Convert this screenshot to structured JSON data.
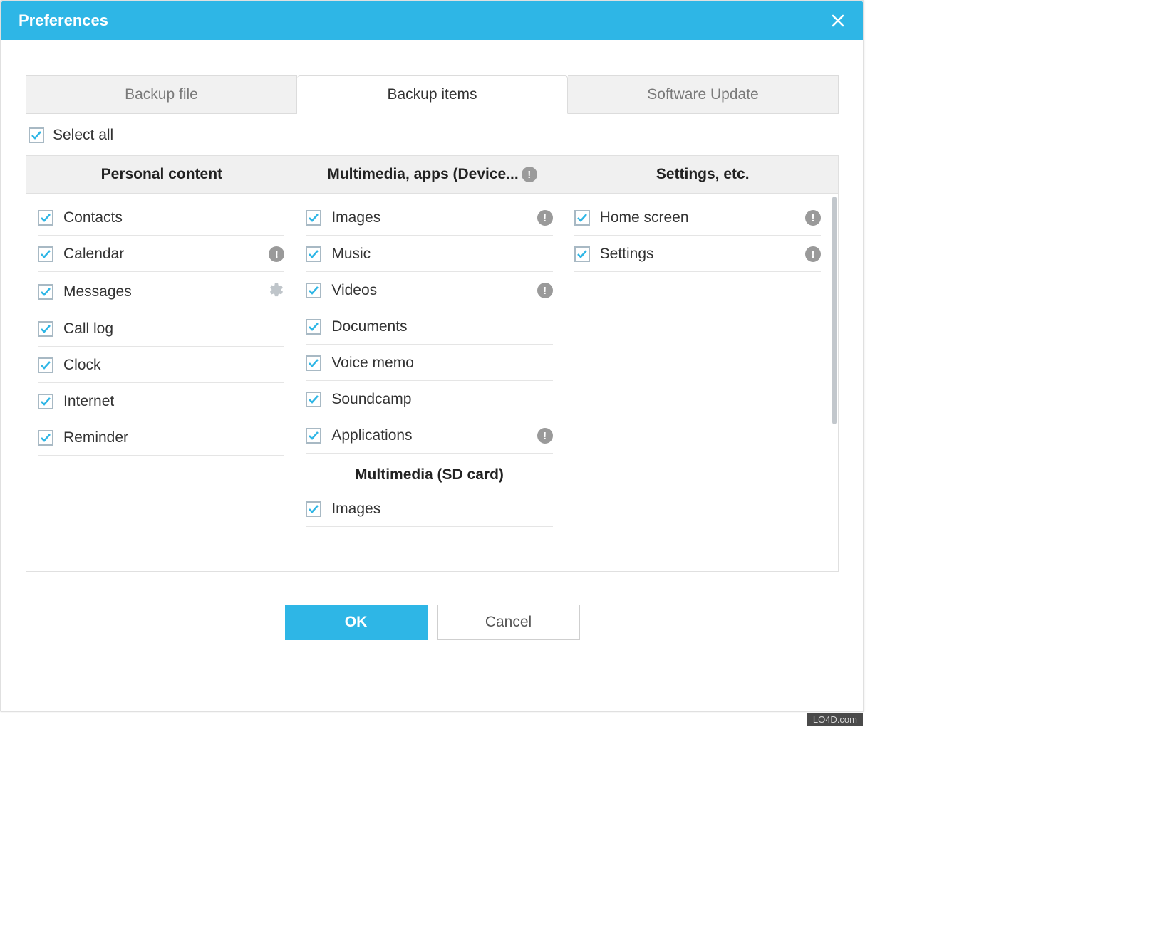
{
  "dialog": {
    "title": "Preferences"
  },
  "tabs": [
    {
      "label": "Backup file",
      "active": false
    },
    {
      "label": "Backup items",
      "active": true
    },
    {
      "label": "Software Update",
      "active": false
    }
  ],
  "select_all": {
    "label": "Select all",
    "checked": true
  },
  "columns": {
    "personal": {
      "header": "Personal content",
      "items": [
        {
          "label": "Contacts",
          "checked": true
        },
        {
          "label": "Calendar",
          "checked": true,
          "info": true
        },
        {
          "label": "Messages",
          "checked": true,
          "gear": true
        },
        {
          "label": "Call log",
          "checked": true
        },
        {
          "label": "Clock",
          "checked": true
        },
        {
          "label": "Internet",
          "checked": true
        },
        {
          "label": "Reminder",
          "checked": true
        }
      ]
    },
    "multimedia": {
      "header": "Multimedia, apps (Device...",
      "header_info": true,
      "items": [
        {
          "label": "Images",
          "checked": true,
          "info": true
        },
        {
          "label": "Music",
          "checked": true
        },
        {
          "label": "Videos",
          "checked": true,
          "info": true
        },
        {
          "label": "Documents",
          "checked": true
        },
        {
          "label": "Voice memo",
          "checked": true
        },
        {
          "label": "Soundcamp",
          "checked": true
        },
        {
          "label": "Applications",
          "checked": true,
          "info": true
        }
      ],
      "subheader": "Multimedia (SD card)",
      "items2": [
        {
          "label": "Images",
          "checked": true
        }
      ]
    },
    "settings": {
      "header": "Settings, etc.",
      "items": [
        {
          "label": "Home screen",
          "checked": true,
          "info": true
        },
        {
          "label": "Settings",
          "checked": true,
          "info": true
        }
      ]
    }
  },
  "buttons": {
    "ok": "OK",
    "cancel": "Cancel"
  },
  "watermark": "LO4D.com"
}
